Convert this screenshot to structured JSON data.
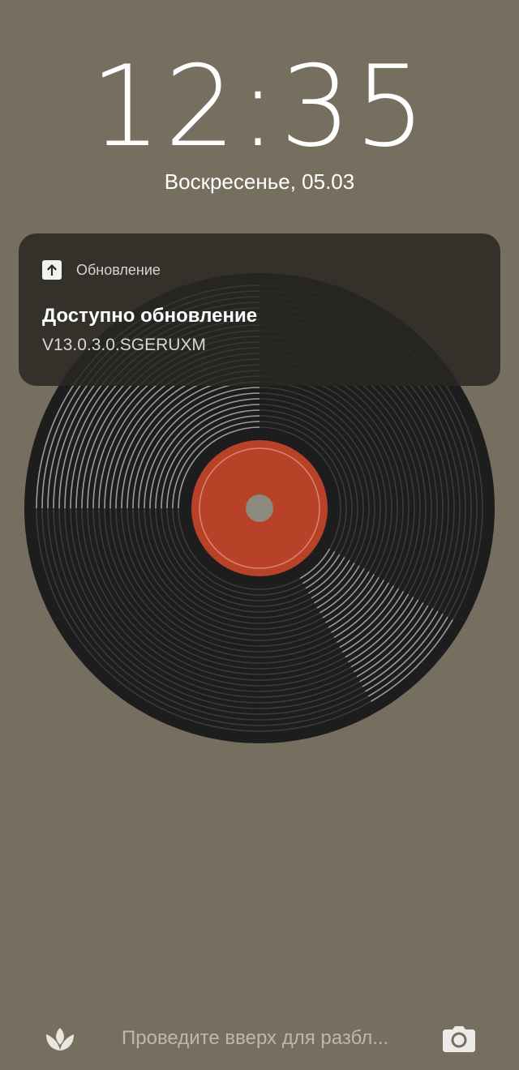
{
  "lockscreen": {
    "time": "12:35",
    "date": "Воскресенье, 05.03",
    "unlock_hint": "Проведите вверх для разбл...",
    "left_shortcut_icon": "leaf-icon",
    "right_shortcut_icon": "camera-icon"
  },
  "notification": {
    "app_icon": "arrow-up-icon",
    "app_name": "Обновление",
    "title": "Доступно обновление",
    "body": "V13.0.3.0.SGERUXM"
  },
  "colors": {
    "background": "#766f60",
    "record": "#1f1f1f",
    "record_label": "#b84228"
  }
}
